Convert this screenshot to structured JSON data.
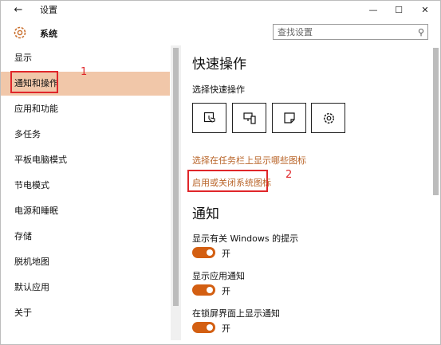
{
  "window": {
    "back_label": "←",
    "title": "设置",
    "minimize": "—",
    "maximize": "☐",
    "close": "✕"
  },
  "header": {
    "title": "系统",
    "search": {
      "placeholder": "查找设置",
      "icon": "search-icon",
      "icon_glyph": "⚲"
    }
  },
  "sidebar": {
    "items": [
      {
        "label": "显示",
        "selected": false
      },
      {
        "label": "通知和操作",
        "selected": true
      },
      {
        "label": "应用和功能",
        "selected": false
      },
      {
        "label": "多任务",
        "selected": false
      },
      {
        "label": "平板电脑模式",
        "selected": false
      },
      {
        "label": "节电模式",
        "selected": false
      },
      {
        "label": "电源和睡眠",
        "selected": false
      },
      {
        "label": "存储",
        "selected": false
      },
      {
        "label": "脱机地图",
        "selected": false
      },
      {
        "label": "默认应用",
        "selected": false
      },
      {
        "label": "关于",
        "selected": false
      }
    ]
  },
  "annotations": {
    "marker1": "1",
    "marker2": "2",
    "color": "#e0262a"
  },
  "quick_actions": {
    "title": "快速操作",
    "subtitle": "选择快速操作",
    "tiles": [
      {
        "icon": "tablet-mode-icon"
      },
      {
        "icon": "connect-display-icon"
      },
      {
        "icon": "note-icon"
      },
      {
        "icon": "settings-gear-icon"
      }
    ],
    "link_taskbar_icons": "选择在任务栏上显示哪些图标",
    "link_system_icons": "启用或关闭系统图标"
  },
  "notifications": {
    "title": "通知",
    "items": [
      {
        "label": "显示有关 Windows 的提示",
        "state": "开",
        "on": true
      },
      {
        "label": "显示应用通知",
        "state": "开",
        "on": true
      },
      {
        "label": "在锁屏界面上显示通知",
        "state": "开",
        "on": true
      }
    ]
  },
  "colors": {
    "accent": "#d35f12",
    "link": "#b9652a",
    "selected_bg": "#f1c7a9"
  }
}
